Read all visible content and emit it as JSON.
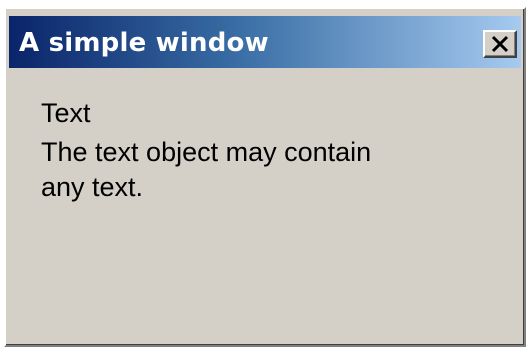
{
  "window": {
    "title": "A simple window",
    "close_icon": "close-icon"
  },
  "content": {
    "heading": "Text",
    "body_line_1": "The text object may contain",
    "body_line_2": "any text."
  },
  "colors": {
    "title_bar_start": "#0a246a",
    "title_bar_end": "#a6caf0",
    "window_face": "#d4d0c8"
  }
}
